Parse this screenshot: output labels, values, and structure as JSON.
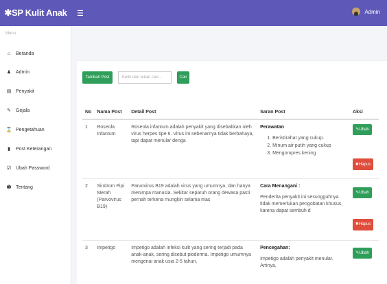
{
  "app": {
    "brand": "✱SP Kulit Anak",
    "user": "Admin"
  },
  "sidebar": {
    "menu_label": "Menu",
    "items": [
      {
        "label": "Beranda",
        "icon": "home-icon"
      },
      {
        "label": "Admin",
        "icon": "user-icon"
      },
      {
        "label": "Penyakit",
        "icon": "bank-icon"
      },
      {
        "label": "Gejala",
        "icon": "pencil-icon"
      },
      {
        "label": "Pengetahuan",
        "icon": "hourglass-icon"
      },
      {
        "label": "Post Keterangan",
        "icon": "file-icon"
      },
      {
        "label": "Ubah Password",
        "icon": "edit-icon"
      },
      {
        "label": "Tentang",
        "icon": "info-icon"
      }
    ]
  },
  "toolbar": {
    "add_label": "Tambah Post",
    "search_placeholder": "Ketik dan tekan cari...",
    "search_label": "Cari"
  },
  "table": {
    "headers": [
      "No",
      "Nama Post",
      "Detail Post",
      "Saran Post",
      "Aksi"
    ],
    "rows": [
      {
        "no": "1",
        "nama": "Roseola Infantum",
        "detail": "Roseola infantum adalah penyakit yang disebabkan oleh virus herpes tipe 6. Virus ini sebenarnya tidak berbahaya, tapi dapat menular denga",
        "saran_title": "Perawatan",
        "saran_list": [
          "Beristirahat yang cukup.",
          "Minum air putih yang cukup",
          "Mengompres kening"
        ]
      },
      {
        "no": "2",
        "nama": "Sindrom Pipi Merah (Parvovirus B19)",
        "detail": "Parvovirus B19 adalah virus yang umumnya, dan hanya menimpa manusia. Sekitar separuh orang dewasa pasti pernah terkena mungkin selama mas",
        "saran_title": "Cara Menangani :",
        "saran_text": "Penderita penyakit ini sesungguhnya tidak memerlukan pengobatan khusus, karena dapat sembuh d"
      },
      {
        "no": "3",
        "nama": "Impetigo",
        "detail": "Impetigo adalah infeksi kulit yang sering terjadi pada anak-anak, sering disebut pioderma. Impetigo umumnya mengenai anak usia 2-5 tahun.",
        "saran_title": "Pencegahan:",
        "saran_text": "Impetigo adalah penyakit menular. Artinya,"
      }
    ],
    "ubah_label": "✎Ubah",
    "hapus_label": "✖Hapus"
  },
  "colors": {
    "topbar": "#5e58b8",
    "green": "#2f9e5a",
    "red": "#e04d3c"
  }
}
